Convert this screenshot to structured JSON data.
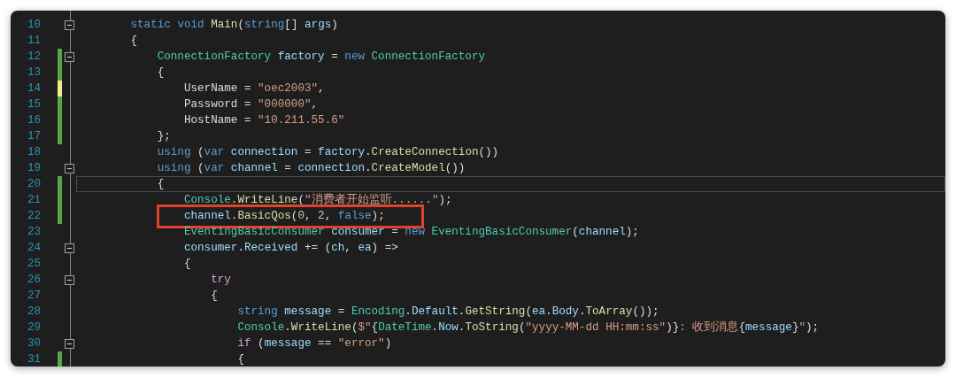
{
  "editor": {
    "lines": [
      {
        "number": "10",
        "fold": true,
        "current": false,
        "boxed": false,
        "tokens": [
          {
            "kind": "keyword",
            "text": "        static "
          },
          {
            "kind": "keyword",
            "text": "void "
          },
          {
            "kind": "method",
            "text": "Main"
          },
          {
            "kind": "plain",
            "text": "("
          },
          {
            "kind": "keyword",
            "text": "string"
          },
          {
            "kind": "plain",
            "text": "[] "
          },
          {
            "kind": "ident",
            "text": "args"
          },
          {
            "kind": "plain",
            "text": ")"
          }
        ]
      },
      {
        "number": "11",
        "fold": false,
        "current": false,
        "boxed": false,
        "tokens": [
          {
            "kind": "plain",
            "text": "        {"
          }
        ]
      },
      {
        "number": "12",
        "color": "#57a64a",
        "fold": true,
        "current": false,
        "boxed": false,
        "tokens": [
          {
            "kind": "type",
            "text": "            ConnectionFactory "
          },
          {
            "kind": "ident",
            "text": "factory"
          },
          {
            "kind": "plain",
            "text": " = "
          },
          {
            "kind": "keyword",
            "text": "new "
          },
          {
            "kind": "type",
            "text": "ConnectionFactory"
          }
        ]
      },
      {
        "number": "13",
        "color": "#57a64a",
        "fold": false,
        "current": false,
        "boxed": false,
        "tokens": [
          {
            "kind": "plain",
            "text": "            {"
          }
        ]
      },
      {
        "number": "14",
        "color": "#eeee88",
        "fold": false,
        "current": false,
        "boxed": false,
        "tokens": [
          {
            "kind": "plain",
            "text": "                UserName = "
          },
          {
            "kind": "string",
            "text": "\"oec2003\""
          },
          {
            "kind": "plain",
            "text": ","
          }
        ]
      },
      {
        "number": "15",
        "color": "#57a64a",
        "fold": false,
        "current": false,
        "boxed": false,
        "tokens": [
          {
            "kind": "plain",
            "text": "                Password = "
          },
          {
            "kind": "string",
            "text": "\"000000\""
          },
          {
            "kind": "plain",
            "text": ","
          }
        ]
      },
      {
        "number": "16",
        "color": "#57a64a",
        "fold": false,
        "current": false,
        "boxed": false,
        "tokens": [
          {
            "kind": "plain",
            "text": "                HostName = "
          },
          {
            "kind": "string",
            "text": "\"10.211.55.6\""
          }
        ]
      },
      {
        "number": "17",
        "color": "#57a64a",
        "fold": false,
        "current": false,
        "boxed": false,
        "tokens": [
          {
            "kind": "plain",
            "text": "            };"
          }
        ]
      },
      {
        "number": "18",
        "fold": false,
        "current": false,
        "boxed": false,
        "tokens": [
          {
            "kind": "keyword",
            "text": "            using"
          },
          {
            "kind": "plain",
            "text": " ("
          },
          {
            "kind": "keyword",
            "text": "var "
          },
          {
            "kind": "ident",
            "text": "connection"
          },
          {
            "kind": "plain",
            "text": " = "
          },
          {
            "kind": "ident",
            "text": "factory"
          },
          {
            "kind": "plain",
            "text": "."
          },
          {
            "kind": "method",
            "text": "CreateConnection"
          },
          {
            "kind": "plain",
            "text": "())"
          }
        ]
      },
      {
        "number": "19",
        "fold": true,
        "current": false,
        "boxed": false,
        "tokens": [
          {
            "kind": "keyword",
            "text": "            using"
          },
          {
            "kind": "plain",
            "text": " ("
          },
          {
            "kind": "keyword",
            "text": "var "
          },
          {
            "kind": "ident",
            "text": "channel"
          },
          {
            "kind": "plain",
            "text": " = "
          },
          {
            "kind": "ident",
            "text": "connection"
          },
          {
            "kind": "plain",
            "text": "."
          },
          {
            "kind": "method",
            "text": "CreateModel"
          },
          {
            "kind": "plain",
            "text": "())"
          }
        ]
      },
      {
        "number": "20",
        "color": "#57a64a",
        "fold": false,
        "current": true,
        "boxed": false,
        "tokens": [
          {
            "kind": "plain",
            "text": "            {"
          }
        ]
      },
      {
        "number": "21",
        "color": "#57a64a",
        "fold": false,
        "current": false,
        "boxed": false,
        "tokens": [
          {
            "kind": "type",
            "text": "                Console"
          },
          {
            "kind": "plain",
            "text": "."
          },
          {
            "kind": "method",
            "text": "WriteLine"
          },
          {
            "kind": "plain",
            "text": "("
          },
          {
            "kind": "string",
            "text": "\"消费者开始监听......\""
          },
          {
            "kind": "plain",
            "text": ");"
          }
        ]
      },
      {
        "number": "22",
        "color": "#57a64a",
        "fold": false,
        "current": false,
        "boxed": true,
        "tokens": [
          {
            "kind": "ident",
            "text": "                channel"
          },
          {
            "kind": "plain",
            "text": "."
          },
          {
            "kind": "method",
            "text": "BasicQos"
          },
          {
            "kind": "plain",
            "text": "("
          },
          {
            "kind": "number",
            "text": "0"
          },
          {
            "kind": "plain",
            "text": ", "
          },
          {
            "kind": "number",
            "text": "2"
          },
          {
            "kind": "plain",
            "text": ", "
          },
          {
            "kind": "keyword",
            "text": "false"
          },
          {
            "kind": "plain",
            "text": ");"
          }
        ]
      },
      {
        "number": "23",
        "fold": false,
        "current": false,
        "boxed": false,
        "tokens": [
          {
            "kind": "type",
            "text": "                EventingBasicConsumer "
          },
          {
            "kind": "ident",
            "text": "consumer"
          },
          {
            "kind": "plain",
            "text": " = "
          },
          {
            "kind": "keyword",
            "text": "new "
          },
          {
            "kind": "type",
            "text": "EventingBasicConsumer"
          },
          {
            "kind": "plain",
            "text": "("
          },
          {
            "kind": "ident",
            "text": "channel"
          },
          {
            "kind": "plain",
            "text": ");"
          }
        ]
      },
      {
        "number": "24",
        "fold": true,
        "current": false,
        "boxed": false,
        "tokens": [
          {
            "kind": "ident",
            "text": "                consumer"
          },
          {
            "kind": "plain",
            "text": "."
          },
          {
            "kind": "ident",
            "text": "Received"
          },
          {
            "kind": "plain",
            "text": " += ("
          },
          {
            "kind": "ident",
            "text": "ch"
          },
          {
            "kind": "plain",
            "text": ", "
          },
          {
            "kind": "ident",
            "text": "ea"
          },
          {
            "kind": "plain",
            "text": ") =>"
          }
        ]
      },
      {
        "number": "25",
        "fold": false,
        "current": false,
        "boxed": false,
        "tokens": [
          {
            "kind": "plain",
            "text": "                {"
          }
        ]
      },
      {
        "number": "26",
        "fold": true,
        "current": false,
        "boxed": false,
        "tokens": [
          {
            "kind": "control",
            "text": "                    try"
          }
        ]
      },
      {
        "number": "27",
        "fold": false,
        "current": false,
        "boxed": false,
        "tokens": [
          {
            "kind": "plain",
            "text": "                    {"
          }
        ]
      },
      {
        "number": "28",
        "fold": false,
        "current": false,
        "boxed": false,
        "tokens": [
          {
            "kind": "keyword",
            "text": "                        string "
          },
          {
            "kind": "ident",
            "text": "message"
          },
          {
            "kind": "plain",
            "text": " = "
          },
          {
            "kind": "type",
            "text": "Encoding"
          },
          {
            "kind": "plain",
            "text": "."
          },
          {
            "kind": "ident",
            "text": "Default"
          },
          {
            "kind": "plain",
            "text": "."
          },
          {
            "kind": "method",
            "text": "GetString"
          },
          {
            "kind": "plain",
            "text": "("
          },
          {
            "kind": "ident",
            "text": "ea"
          },
          {
            "kind": "plain",
            "text": "."
          },
          {
            "kind": "ident",
            "text": "Body"
          },
          {
            "kind": "plain",
            "text": "."
          },
          {
            "kind": "method",
            "text": "ToArray"
          },
          {
            "kind": "plain",
            "text": "());"
          }
        ]
      },
      {
        "number": "29",
        "fold": false,
        "current": false,
        "boxed": false,
        "tokens": [
          {
            "kind": "type",
            "text": "                        Console"
          },
          {
            "kind": "plain",
            "text": "."
          },
          {
            "kind": "method",
            "text": "WriteLine"
          },
          {
            "kind": "plain",
            "text": "("
          },
          {
            "kind": "string",
            "text": "$\""
          },
          {
            "kind": "plain",
            "text": "{"
          },
          {
            "kind": "type",
            "text": "DateTime"
          },
          {
            "kind": "plain",
            "text": "."
          },
          {
            "kind": "ident",
            "text": "Now"
          },
          {
            "kind": "plain",
            "text": "."
          },
          {
            "kind": "method",
            "text": "ToString"
          },
          {
            "kind": "plain",
            "text": "("
          },
          {
            "kind": "string",
            "text": "\"yyyy-MM-dd HH:mm:ss\""
          },
          {
            "kind": "plain",
            "text": ")}"
          },
          {
            "kind": "string",
            "text": ": 收到消息"
          },
          {
            "kind": "plain",
            "text": "{"
          },
          {
            "kind": "ident",
            "text": "message"
          },
          {
            "kind": "plain",
            "text": "}"
          },
          {
            "kind": "string",
            "text": "\""
          },
          {
            "kind": "plain",
            "text": ");"
          }
        ]
      },
      {
        "number": "30",
        "fold": true,
        "current": false,
        "boxed": false,
        "tokens": [
          {
            "kind": "control",
            "text": "                        if"
          },
          {
            "kind": "plain",
            "text": " ("
          },
          {
            "kind": "ident",
            "text": "message"
          },
          {
            "kind": "plain",
            "text": " == "
          },
          {
            "kind": "string",
            "text": "\"error\""
          },
          {
            "kind": "plain",
            "text": ")"
          }
        ]
      },
      {
        "number": "31",
        "color": "#57a64a",
        "fold": false,
        "current": false,
        "boxed": false,
        "tokens": [
          {
            "kind": "plain",
            "text": "                        {"
          }
        ]
      }
    ]
  }
}
